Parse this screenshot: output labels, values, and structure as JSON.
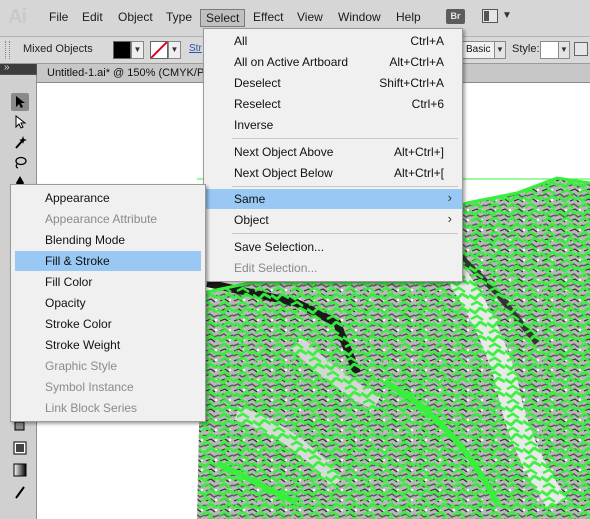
{
  "app": {
    "logo": "Ai"
  },
  "menubar": {
    "items": [
      "File",
      "Edit",
      "Object",
      "Type",
      "Select",
      "Effect",
      "View",
      "Window",
      "Help"
    ],
    "active": "Select",
    "bridge_badge": "Br"
  },
  "control_bar": {
    "selection_label": "Mixed Objects",
    "stroke_link": "Str",
    "basic_value": "Basic",
    "style_label": "Style:"
  },
  "document": {
    "title": "Untitled-1.ai* @ 150% (CMYK/P"
  },
  "select_menu": {
    "items": [
      {
        "label": "All",
        "shortcut": "Ctrl+A",
        "disabled": false
      },
      {
        "label": "All on Active Artboard",
        "shortcut": "Alt+Ctrl+A",
        "disabled": false
      },
      {
        "label": "Deselect",
        "shortcut": "Shift+Ctrl+A",
        "disabled": false
      },
      {
        "label": "Reselect",
        "shortcut": "Ctrl+6",
        "disabled": false
      },
      {
        "label": "Inverse",
        "shortcut": "",
        "disabled": false
      },
      {
        "label": "Next Object Above",
        "shortcut": "Alt+Ctrl+]",
        "disabled": false
      },
      {
        "label": "Next Object Below",
        "shortcut": "Alt+Ctrl+[",
        "disabled": false
      },
      {
        "label": "Same",
        "shortcut": "",
        "disabled": false,
        "submenu": true,
        "highlight": true
      },
      {
        "label": "Object",
        "shortcut": "",
        "disabled": false,
        "submenu": true
      },
      {
        "label": "Save Selection...",
        "shortcut": "",
        "disabled": false
      },
      {
        "label": "Edit Selection...",
        "shortcut": "",
        "disabled": true
      }
    ]
  },
  "same_submenu": {
    "items": [
      {
        "label": "Appearance",
        "disabled": false
      },
      {
        "label": "Appearance Attribute",
        "disabled": true
      },
      {
        "label": "Blending Mode",
        "disabled": false
      },
      {
        "label": "Fill & Stroke",
        "disabled": false,
        "highlight": true
      },
      {
        "label": "Fill Color",
        "disabled": false
      },
      {
        "label": "Opacity",
        "disabled": false
      },
      {
        "label": "Stroke Color",
        "disabled": false
      },
      {
        "label": "Stroke Weight",
        "disabled": false
      },
      {
        "label": "Graphic Style",
        "disabled": true
      },
      {
        "label": "Symbol Instance",
        "disabled": true
      },
      {
        "label": "Link Block Series",
        "disabled": true
      }
    ]
  },
  "colors": {
    "highlight": "#99c8f4",
    "selection_outline": "#37f03c",
    "fill": "#000000",
    "stroke_none": "#e0001b"
  },
  "icons": {
    "tools": [
      "selection-tool-icon",
      "direct-selection-tool-icon",
      "magic-wand-tool-icon",
      "lasso-tool-icon",
      "pen-tool-icon",
      "gradient-tool-icon",
      "eyedropper-tool-icon"
    ]
  }
}
